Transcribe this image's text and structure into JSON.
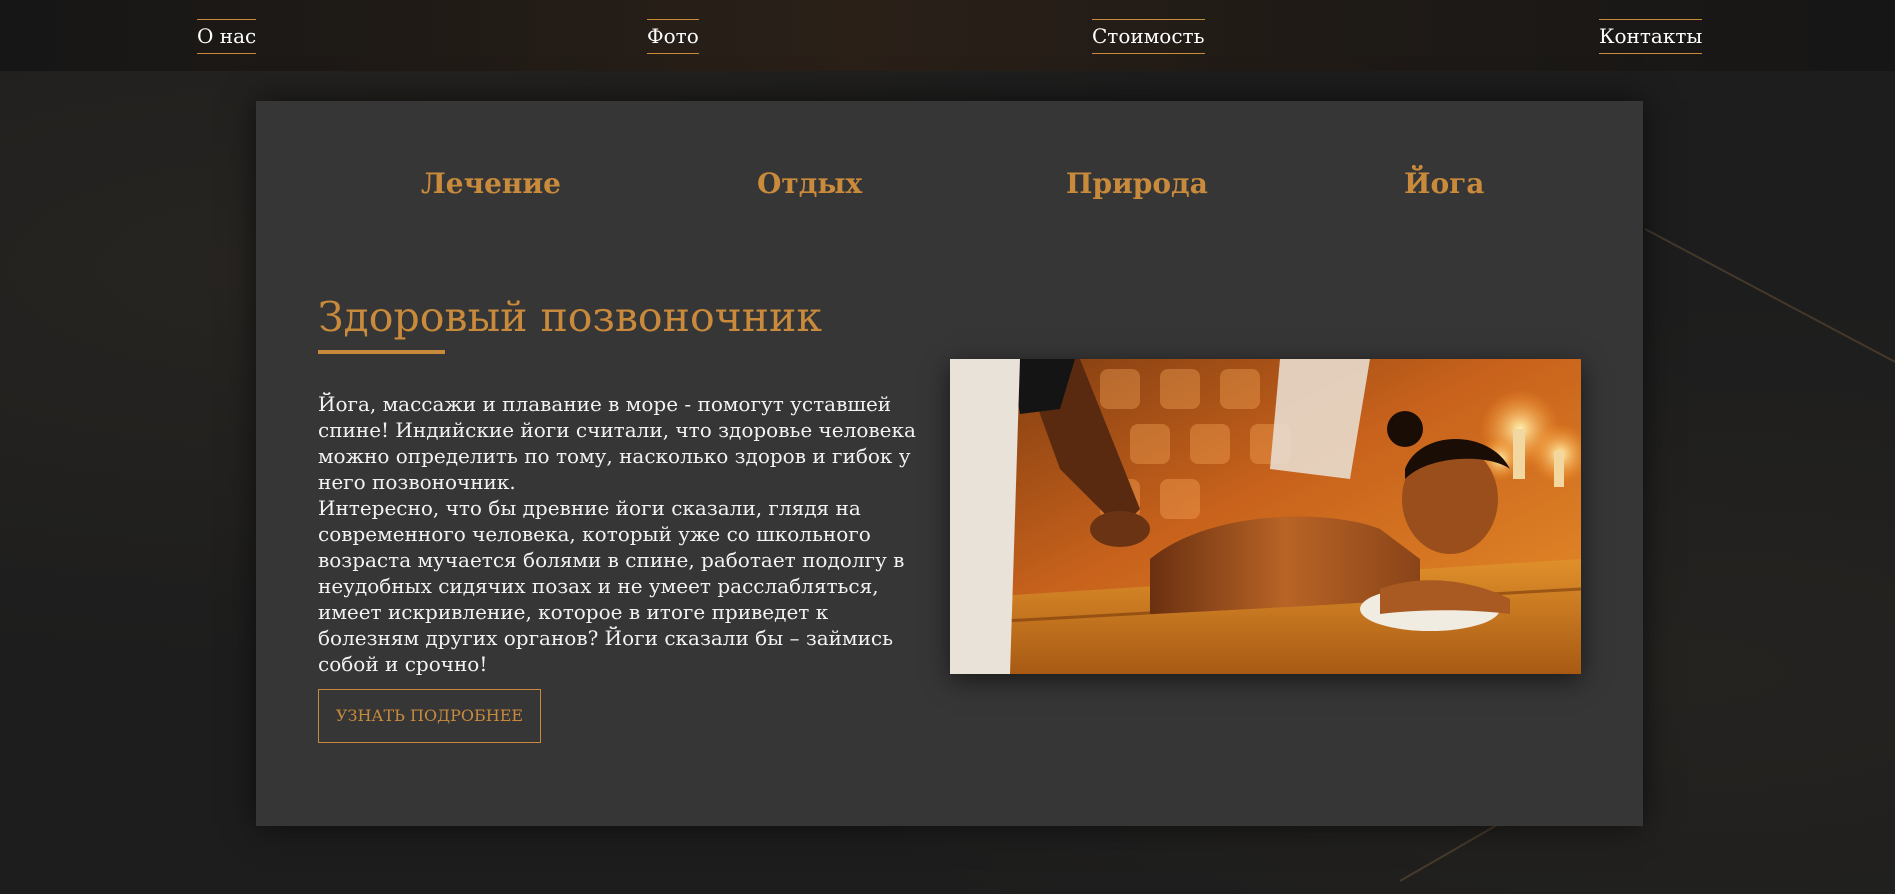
{
  "nav": {
    "items": [
      {
        "label": "О нас"
      },
      {
        "label": "Фото"
      },
      {
        "label": "Стоимость"
      },
      {
        "label": "Контакты"
      }
    ]
  },
  "tabs": [
    {
      "label": "Лечение"
    },
    {
      "label": "Отдых"
    },
    {
      "label": "Природа"
    },
    {
      "label": "Йога"
    }
  ],
  "section": {
    "title": "Здоровый позвоночник",
    "paragraphs": [
      "Йога, массажи и плавание в море - помогут уставшей спине! Индийские йоги считали, что здоровье человека можно определить по тому, насколько здоров и гибок у него позвоночник.",
      "Интересно, что бы древние йоги сказали, глядя на современного человека, который уже со школьного возраста мучается болями в спине, работает подолгу в неудобных сидячих позах и не умеет расслабляться, имеет искривление, которое в итоге приведет к болезням других органов? Йоги сказали бы – займись собой и срочно!"
    ],
    "button_label": "УЗНАТЬ ПОДРОБНЕЕ",
    "image": "massage-photo"
  },
  "colors": {
    "accent": "#c98a3c",
    "card": "#363636",
    "background": "#1d1d1d",
    "text": "#f2f2f2"
  }
}
